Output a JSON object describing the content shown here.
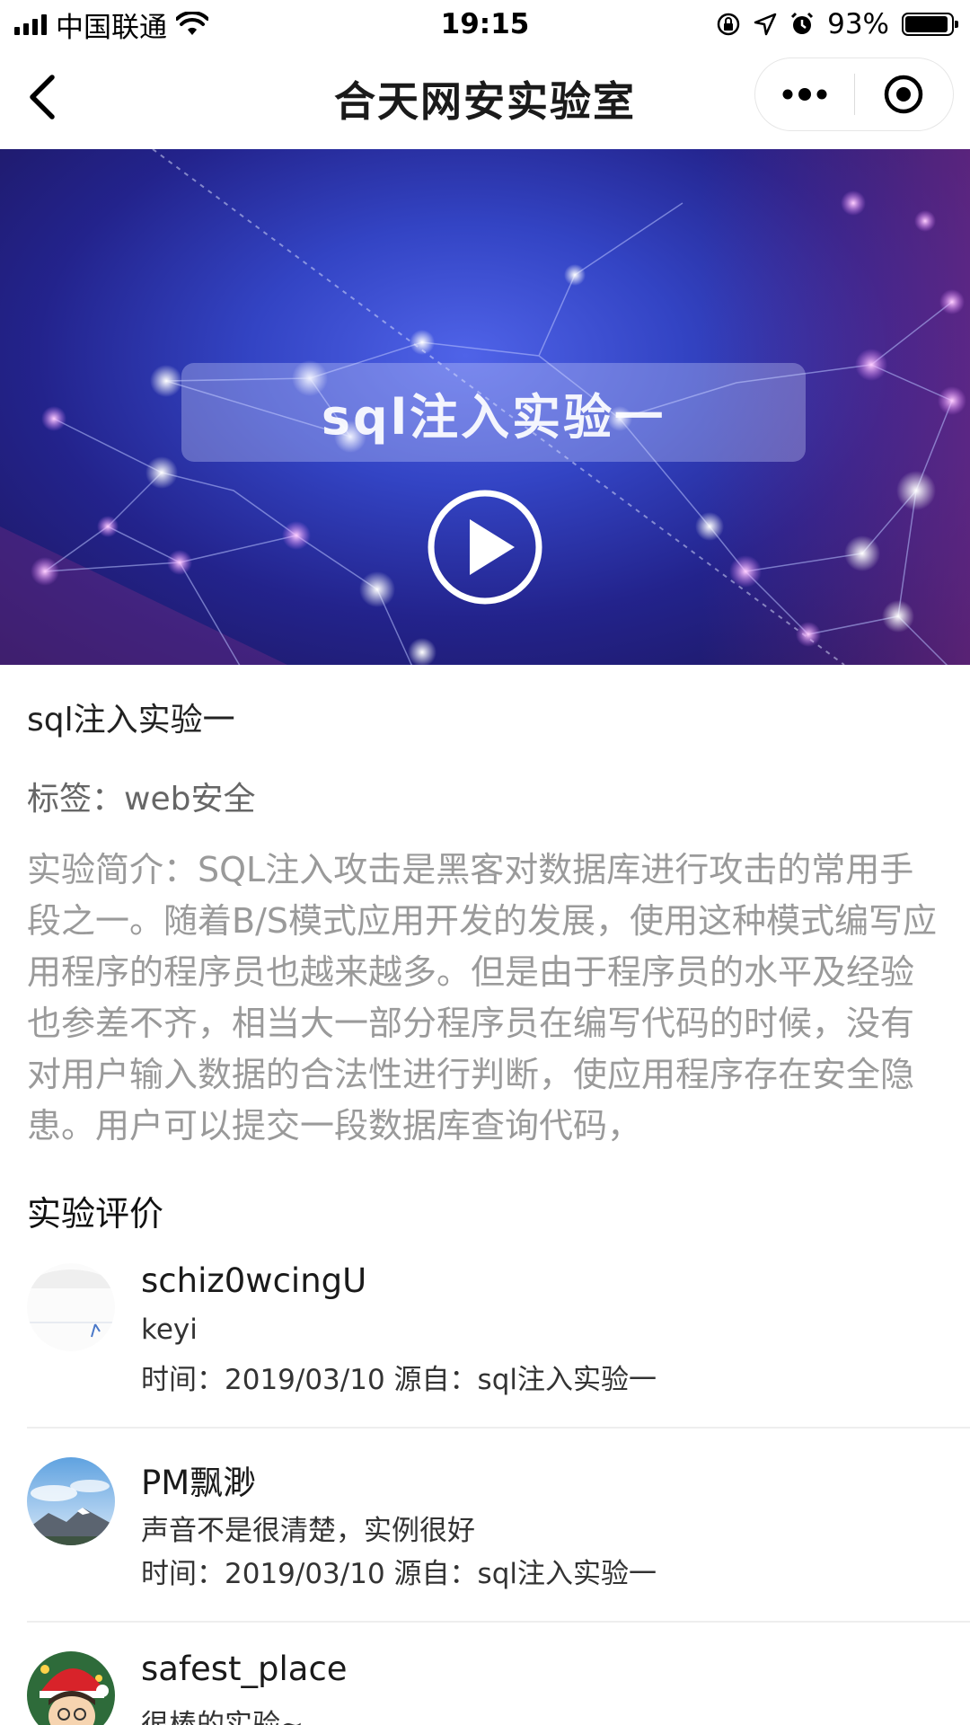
{
  "status_bar": {
    "carrier": "中国联通",
    "time": "19:15",
    "battery_text": "93%",
    "battery_level": 0.93
  },
  "nav": {
    "title": "合天网安实验室",
    "icons": [
      "back-chevron-icon",
      "more-dots-icon",
      "close-target-icon"
    ]
  },
  "video": {
    "banner_text": "sql注入实验一",
    "play_icon": "play-icon"
  },
  "experiment": {
    "title": "sql注入实验一",
    "tag_label": "标签：",
    "tag_value": "web安全",
    "description": "实验简介：SQL注入攻击是黑客对数据库进行攻击的常用手段之一。随着B/S模式应用开发的发展，使用这种模式编写应用程序的程序员也越来越多。但是由于程序员的水平及经验也参差不齐，相当大一部分程序员在编写代码的时候，没有对用户输入数据的合法性进行判断，使应用程序存在安全隐患。用户可以提交一段数据库查询代码，"
  },
  "reviews": {
    "section_title": "实验评价",
    "items": [
      {
        "username": "schiz0wcingU",
        "comment": "keyi",
        "time_label": "时间：",
        "time": "2019/03/10",
        "source_label": "源自：",
        "source": "sql注入实验一"
      },
      {
        "username": "PM飘渺",
        "comment": "声音不是很清楚，实例很好",
        "time_label": "时间：",
        "time": "2019/03/10",
        "source_label": "源自：",
        "source": "sql注入实验一"
      },
      {
        "username": "safest_place",
        "comment": "很棒的实验~"
      }
    ]
  }
}
